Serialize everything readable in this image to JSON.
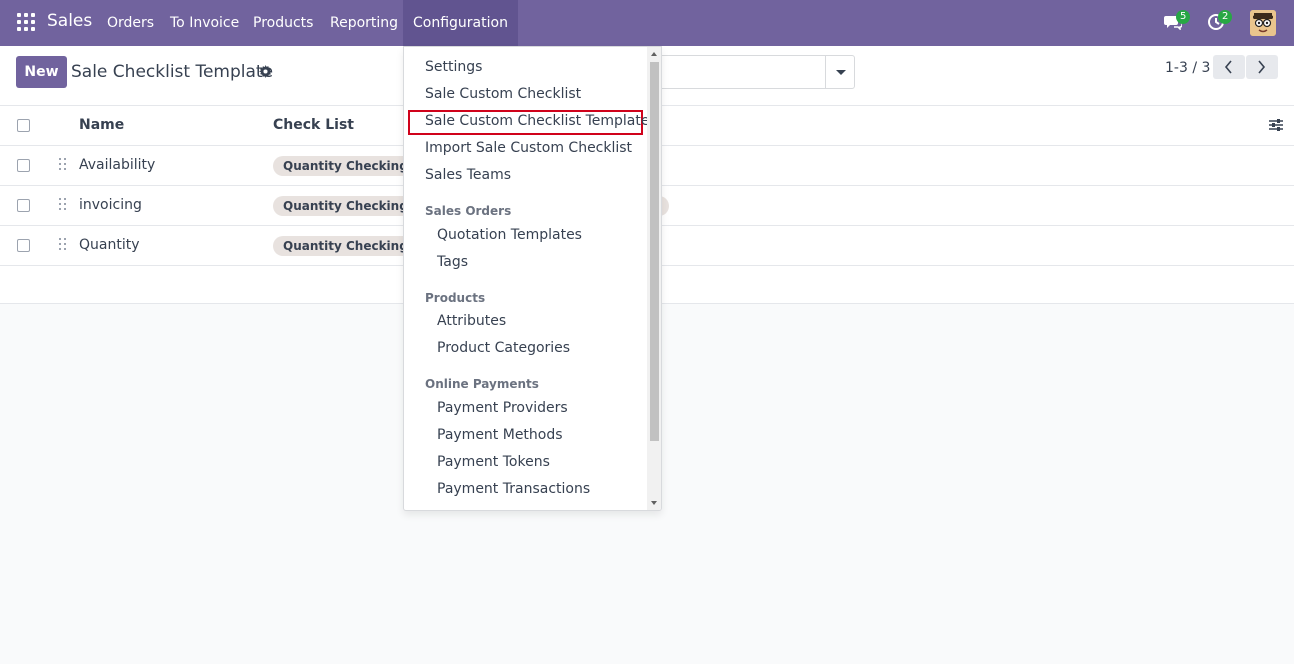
{
  "navbar": {
    "brand": "Sales",
    "menu": [
      "Orders",
      "To Invoice",
      "Products",
      "Reporting",
      "Configuration"
    ],
    "chat_badge": "5",
    "activity_badge": "2",
    "accent_color": "#71639e"
  },
  "control_panel": {
    "new_button": "New",
    "title": "Sale Checklist Template",
    "pager": "1-3 / 3"
  },
  "list": {
    "columns": [
      "Name",
      "Check List"
    ],
    "rows": [
      {
        "name": "Availability",
        "tag": "Quantity Checking"
      },
      {
        "name": "invoicing",
        "tag": "Quantity Checking"
      },
      {
        "name": "Quantity",
        "tag": "Quantity Checking"
      }
    ]
  },
  "dropdown": {
    "items": [
      "Settings",
      "Sale Custom Checklist",
      "Sale Custom Checklist Template",
      "Import Sale Custom Checklist",
      "Sales Teams"
    ],
    "sections": [
      {
        "title": "Sales Orders",
        "items": [
          "Quotation Templates",
          "Tags"
        ]
      },
      {
        "title": "Products",
        "items": [
          "Attributes",
          "Product Categories"
        ]
      },
      {
        "title": "Online Payments",
        "items": [
          "Payment Providers",
          "Payment Methods",
          "Payment Tokens",
          "Payment Transactions"
        ]
      }
    ],
    "highlight_color": "#d0021b"
  }
}
